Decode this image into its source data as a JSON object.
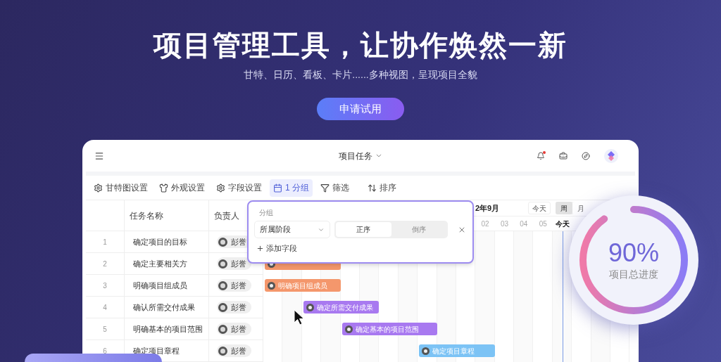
{
  "hero": {
    "title": "项目管理工具，让协作焕然一新",
    "subtitle": "甘特、日历、看板、卡片......多种视图，呈现项目全貌",
    "cta": "申请试用"
  },
  "app": {
    "title": "项目任务",
    "notification": true,
    "toolbar": [
      {
        "label": "甘特图设置",
        "kind": "gear",
        "selected": false
      },
      {
        "label": "外观设置",
        "kind": "shirt",
        "selected": false
      },
      {
        "label": "字段设置",
        "kind": "gear",
        "selected": false
      },
      {
        "label": "1 分组",
        "kind": "calendar",
        "selected": true
      },
      {
        "label": "筛选",
        "kind": "filter",
        "selected": false
      },
      {
        "label": "排序",
        "kind": "sort",
        "selected": false
      }
    ],
    "table": {
      "columns": [
        "任务名称",
        "负责人"
      ],
      "rows": [
        {
          "index": "1",
          "name": "确定项目的目标",
          "owner": "彭誉"
        },
        {
          "index": "2",
          "name": "确定主要相关方",
          "owner": "彭誉"
        },
        {
          "index": "3",
          "name": "明确项目组成员",
          "owner": "彭誉"
        },
        {
          "index": "4",
          "name": "确认所需交付成果",
          "owner": "彭誉"
        },
        {
          "index": "5",
          "name": "明确基本的项目范围",
          "owner": "彭誉"
        },
        {
          "index": "6",
          "name": "确定项目章程",
          "owner": "彭誉"
        }
      ]
    },
    "gantt": {
      "month": "2年9月",
      "today_button": "今天",
      "scales": [
        {
          "label": "周",
          "selected": true
        },
        {
          "label": "月",
          "selected": false
        }
      ],
      "days": [
        {
          "label": "02",
          "today": false
        },
        {
          "label": "03",
          "today": false
        },
        {
          "label": "04",
          "today": false
        },
        {
          "label": "05",
          "today": false
        },
        {
          "label": "今天",
          "today": true
        }
      ],
      "bars": [
        {
          "color": "#f4976c"
        },
        {
          "label": "明确项目组成员",
          "color": "#f4976c"
        },
        {
          "label": "确定所需交付成果",
          "color": "#a879f0"
        },
        {
          "label": "确定基本的项目范围",
          "color": "#a879f0"
        },
        {
          "label": "确定项目章程",
          "color": "#7cc3f5"
        }
      ]
    },
    "popover": {
      "title": "分组",
      "field": "所属阶段",
      "orders": [
        {
          "label": "正序",
          "selected": true
        },
        {
          "label": "倒序",
          "selected": false
        }
      ],
      "add": "添加字段"
    }
  },
  "progress": {
    "value": "90%",
    "label": "项目总进度",
    "level": 0.9
  }
}
